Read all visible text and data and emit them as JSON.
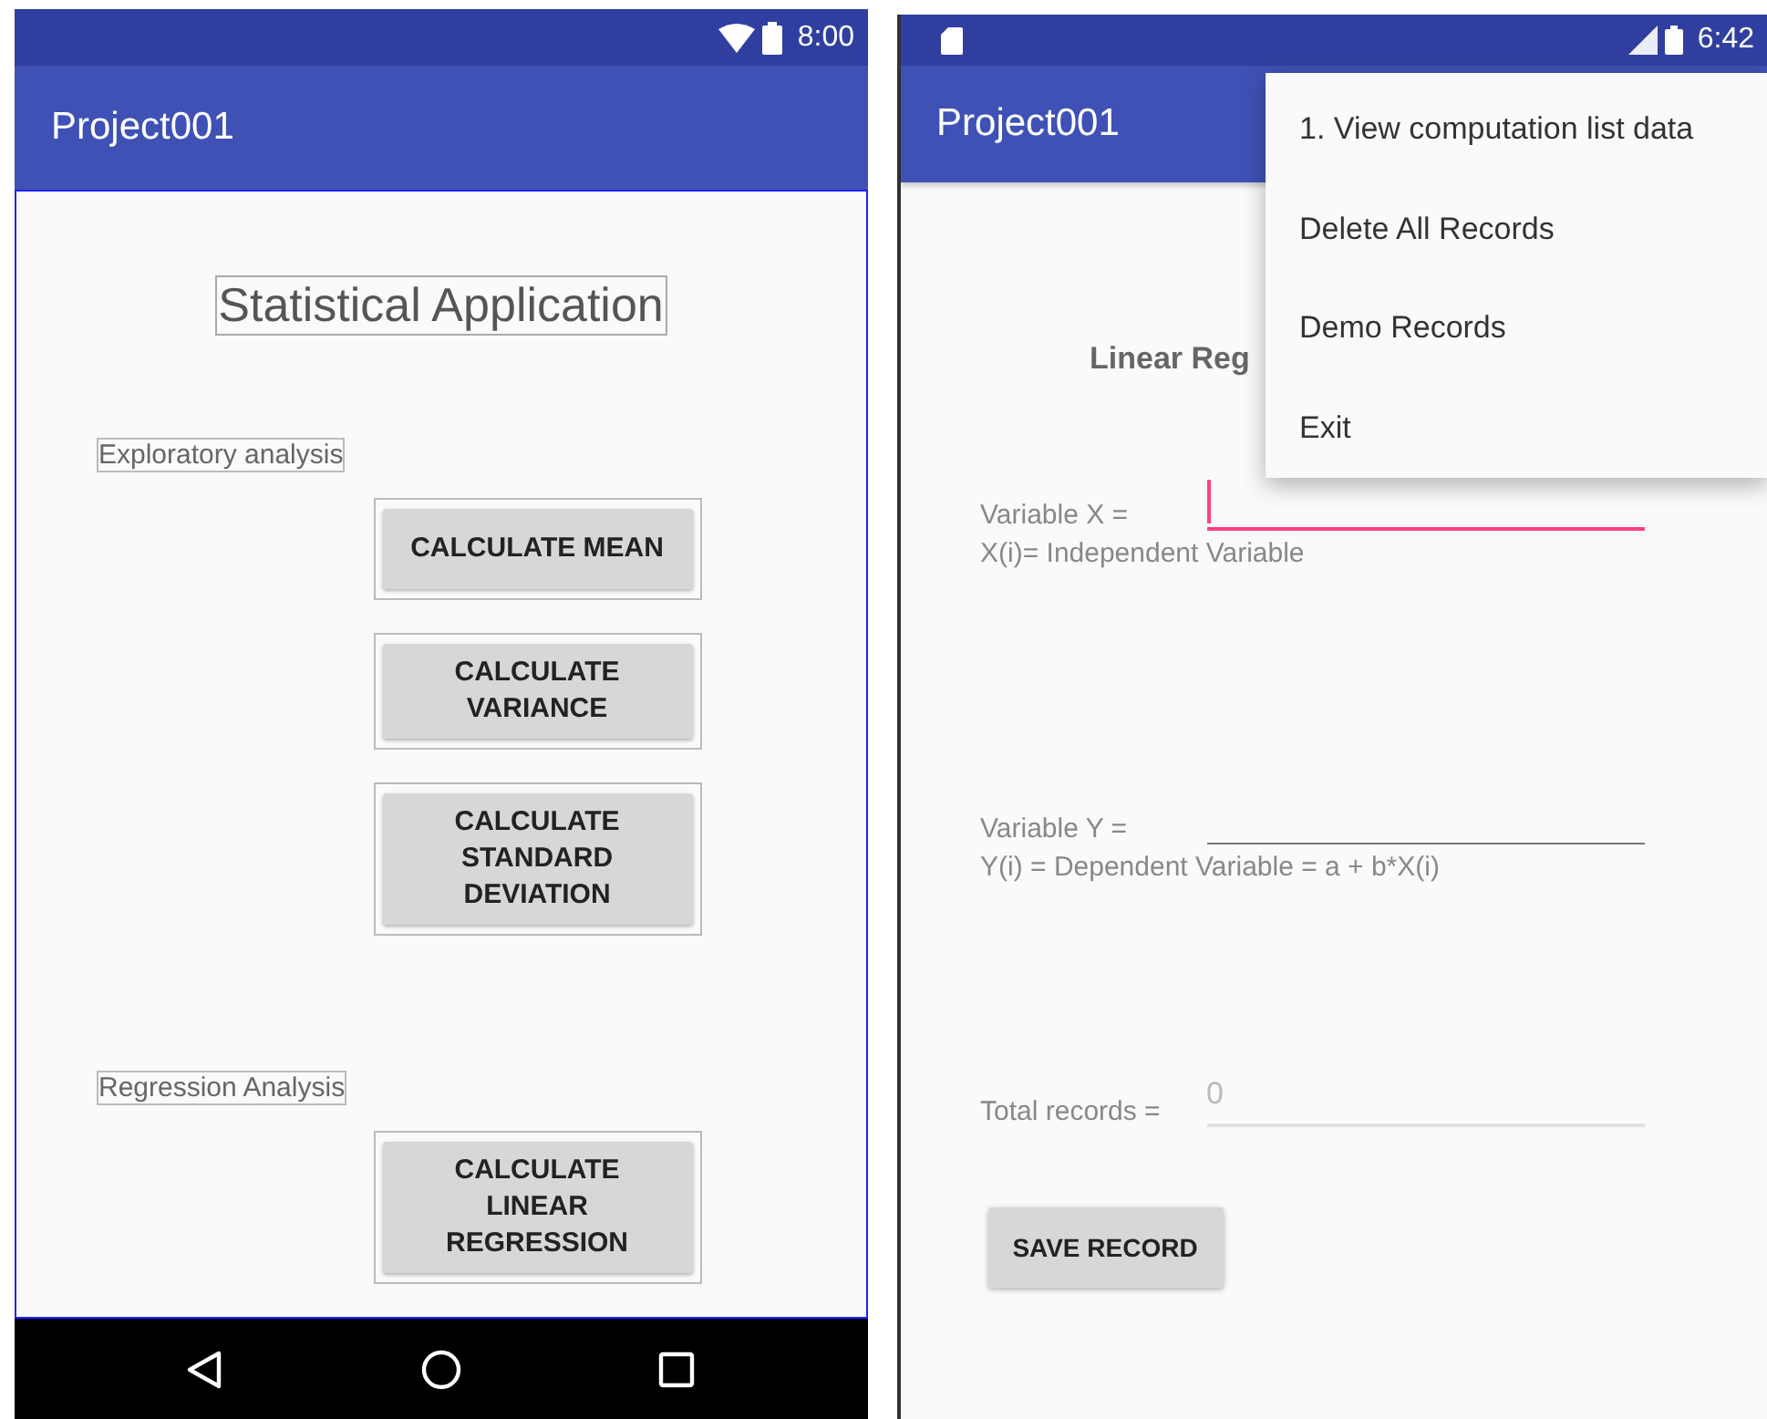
{
  "left_screen": {
    "status_bar": {
      "time": "8:00"
    },
    "app_bar": {
      "title": "Project001"
    },
    "heading": "Statistical Application",
    "sections": [
      {
        "label": "Exploratory analysis",
        "buttons": [
          "CALCULATE MEAN",
          "CALCULATE\nVARIANCE",
          "CALCULATE\nSTANDARD\nDEVIATION"
        ]
      },
      {
        "label": "Regression Analysis",
        "buttons": [
          "CALCULATE\nLINEAR\nREGRESSION"
        ]
      }
    ]
  },
  "right_screen": {
    "status_bar": {
      "time": "6:42"
    },
    "app_bar": {
      "title": "Project001"
    },
    "heading": "Linear Reg",
    "fields": [
      {
        "label": "Variable X =",
        "hint": "X(i)= Independent Variable",
        "focused": true
      },
      {
        "label": "Variable Y =",
        "hint": "Y(i) = Dependent Variable = a + b*X(i)",
        "focused": false
      },
      {
        "label": "Total records =",
        "value": "0",
        "focused": false
      }
    ],
    "save_button": "SAVE RECORD",
    "menu": [
      "1. View computation list data",
      "Delete All Records",
      "Demo Records",
      "Exit"
    ]
  }
}
